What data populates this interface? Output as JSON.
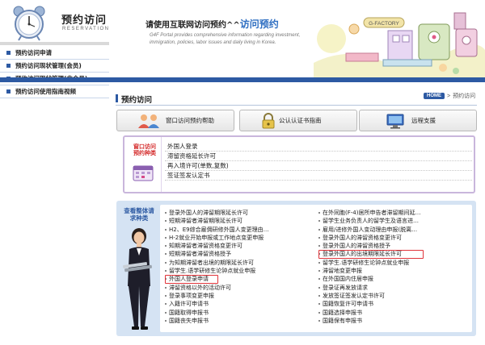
{
  "site": {
    "title": "预约访问",
    "subtitle": "RESERVATION"
  },
  "header": {
    "tagline_main": "请使用互联网访问预约^^",
    "tagline_accent": "访问预约",
    "tagline_en": "G4F Portal provides comprehensive information regarding investment, immigration, policies, labor issues and daily living in Korea.",
    "illustration_badge": "G-FACTORY"
  },
  "sidebar": {
    "items": [
      {
        "label": "预约访问申请"
      },
      {
        "label": "预约访问现状管理(会员)"
      },
      {
        "label": "预约访问现状管理(非会员)"
      },
      {
        "label": "预约访问使用指南视频"
      }
    ]
  },
  "page": {
    "title": "预约访问",
    "breadcrumb_home": "HOME",
    "breadcrumb_current": "预约访问"
  },
  "top_buttons": {
    "window_help": "窗口访问预约帮助",
    "cert_guide": "公认认证书指南",
    "remote_support": "远程支援"
  },
  "visit_box": {
    "label": "窗口访问预约种类",
    "items": [
      "外国人登录",
      "滞留资格延长许可",
      "再入境许可(单数,复数)",
      "签证签发认定书"
    ]
  },
  "request_box": {
    "label": "查看整体请求种类",
    "left_items": [
      "登录外国人的滞留期限延长许可",
      "短期滞留者滞留期限延长许可",
      "H2、E9综合雇佣研修外国人变更理由…",
      "H-2就业开始申报或工作地点变更申报",
      "知期滞留者滞留资格变更许可",
      "短期滞留者滞留资格授予",
      "为知期滞留者出境的期限延长许可",
      "留学生.语学研修生论钟点就业申报",
      "外国人登录申请",
      "滞留资格以外的活动许可",
      "登录事项变更申报",
      "入籍许可申请书",
      "国籍取得申报书",
      "国籍丧失申报书"
    ],
    "right_items": [
      "在外同胞(F-4)居所申告者滞留期间延…",
      "留学生业务负责人的留学生及语言进…",
      "雇用/进修外国人变动理由申报(脱离…",
      "登录外国人的滞留资格变更许可",
      "登录外国人的滞留资格授予",
      "登录外国人的出境期限延长许可",
      "留学生.语学研修生论钟点就业申报",
      "滞留地变更申报",
      "在外国国内住居申报",
      "登录证再发放请求",
      "发放签证签发认定书许可",
      "国籍恢复许可申请书",
      "国籍选择申报书",
      "国籍保有申报书"
    ],
    "highlighted": [
      "外国人登录申请",
      "登录外国人的出境期限延长许可"
    ]
  },
  "colors": {
    "primary": "#2d5aa3",
    "accent_text": "#2f6fc2",
    "highlight": "#e0343a",
    "visit_border": "#c9b6dc",
    "request_bg": "#d5e3f3"
  }
}
